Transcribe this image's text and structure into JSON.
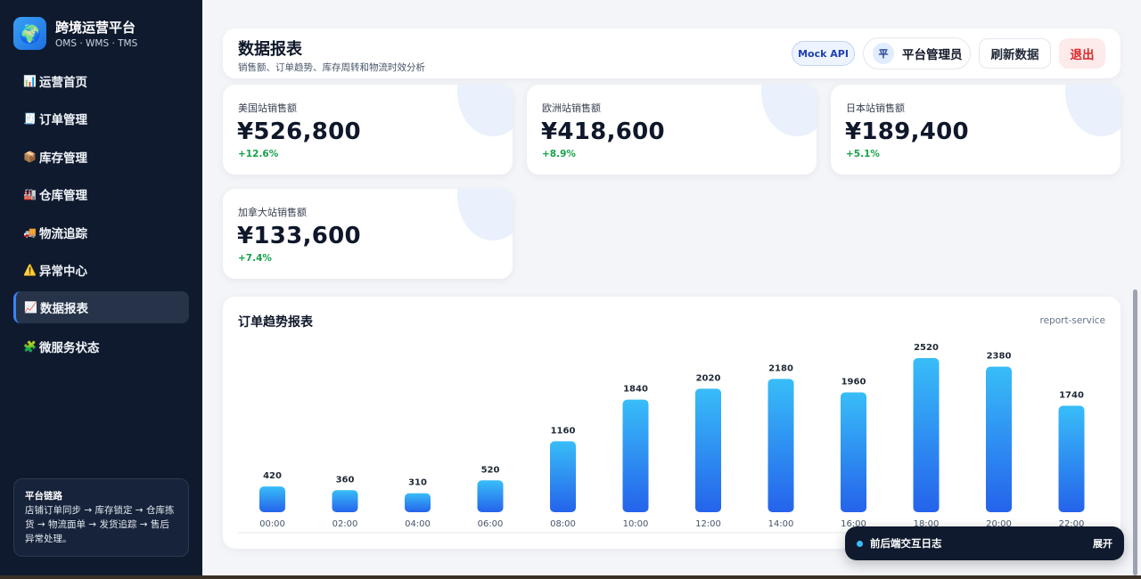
{
  "brand": {
    "logo_icon": "🌍",
    "title": "跨境运营平台",
    "subtitle": "OMS · WMS · TMS"
  },
  "sidebar": {
    "items": [
      {
        "icon": "📊",
        "label": "运营首页"
      },
      {
        "icon": "🧾",
        "label": "订单管理"
      },
      {
        "icon": "📦",
        "label": "库存管理"
      },
      {
        "icon": "🏭",
        "label": "仓库管理"
      },
      {
        "icon": "🚚",
        "label": "物流追踪"
      },
      {
        "icon": "⚠️",
        "label": "异常中心"
      },
      {
        "icon": "📈",
        "label": "数据报表",
        "active": true
      },
      {
        "icon": "🧩",
        "label": "微服务状态"
      }
    ],
    "chain_title": "平台链路",
    "chain_text": "店铺订单同步 → 库存锁定 → 仓库拣货 → 物流面单 → 发货追踪 → 售后异常处理。"
  },
  "header": {
    "title": "数据报表",
    "subtitle": "销售额、订单趋势、库存周转和物流时效分析",
    "mock_badge": "Mock API",
    "user_avatar": "平",
    "user_name": "平台管理员",
    "refresh_label": "刷新数据",
    "logout_label": "退出"
  },
  "stats": [
    {
      "label": "美国站销售额",
      "value": "¥526,800",
      "change": "+12.6%"
    },
    {
      "label": "欧洲站销售额",
      "value": "¥418,600",
      "change": "+8.9%"
    },
    {
      "label": "日本站销售额",
      "value": "¥189,400",
      "change": "+5.1%"
    },
    {
      "label": "加拿大站销售额",
      "value": "¥133,600",
      "change": "+7.4%"
    }
  ],
  "chart_card": {
    "title": "订单趋势报表",
    "service": "report-service"
  },
  "chart_data": {
    "type": "bar",
    "categories": [
      "00:00",
      "02:00",
      "04:00",
      "06:00",
      "08:00",
      "10:00",
      "12:00",
      "14:00",
      "16:00",
      "18:00",
      "20:00",
      "22:00"
    ],
    "values": [
      420,
      360,
      310,
      520,
      1160,
      1840,
      2020,
      2180,
      1960,
      2520,
      2380,
      1740
    ],
    "title": "订单趋势报表",
    "xlabel": "",
    "ylabel": "",
    "ylim": [
      0,
      2520
    ],
    "grid": false,
    "colors": {
      "top": "#38bdf8",
      "bottom": "#2563eb"
    }
  },
  "log_bar": {
    "title": "前后端交互日志",
    "expand_label": "展开"
  }
}
